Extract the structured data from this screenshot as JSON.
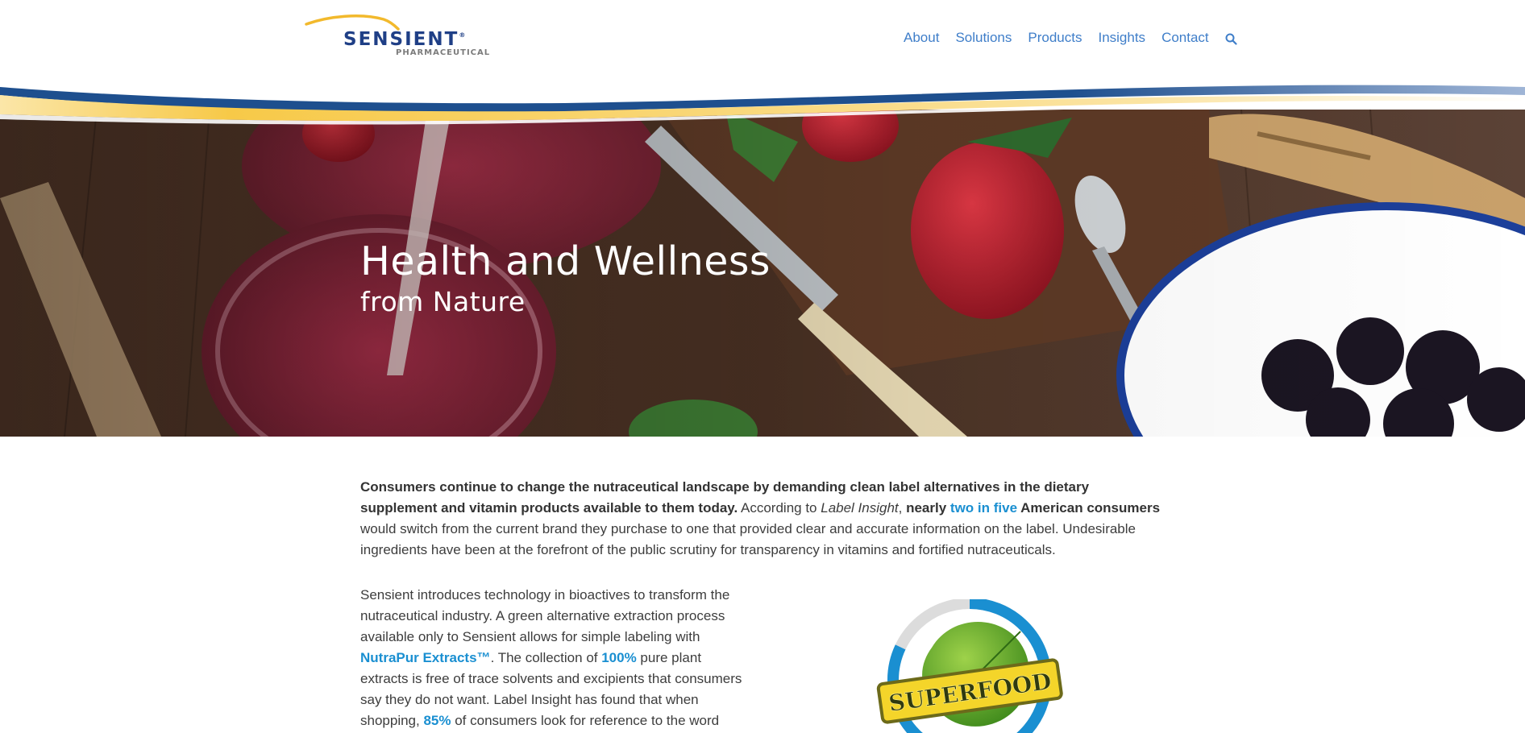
{
  "brand": {
    "name": "SENSIENT",
    "registered": "®",
    "division": "PHARMACEUTICAL"
  },
  "nav": {
    "items": [
      "About",
      "Solutions",
      "Products",
      "Insights",
      "Contact"
    ],
    "search_icon": "search-icon"
  },
  "hero": {
    "title": "Health and Wellness",
    "subtitle": "from Nature"
  },
  "lead": {
    "bold_intro": "Consumers continue to change the nutraceutical landscape by demanding clean label alternatives in the dietary supplement and vitamin products available to them today.",
    "according_to": " According to ",
    "source": "Label Insight",
    "comma": ", ",
    "nearly": "nearly ",
    "stat": "two in five",
    "american_consumers": " American consumers",
    "rest": " would switch from the current brand they purchase to one that provided clear and accurate information on the label. Undesirable ingredients have been at the forefront of the public scrutiny for transparency in vitamins and fortified nutraceuticals."
  },
  "para": {
    "part1": "Sensient introduces technology in bioactives to transform the nutraceutical industry. A green alternative extraction process available only to Sensient allows for simple labeling with ",
    "product": "NutraPur Extracts™",
    "part2": ". The collection of ",
    "stat1": "100%",
    "part3": " pure plant extracts is free of trace solvents and excipients that consumers say they do not want. Label Insight has found that when shopping, ",
    "stat2": "85%",
    "part4": " of consumers look for reference to the word"
  },
  "badge": {
    "label": "SUPERFOOD",
    "progress_fraction": 0.82
  },
  "colors": {
    "brand_blue": "#1f3f86",
    "nav_link": "#3f7ec9",
    "highlight": "#1a8fd1",
    "wave_yellow": "#f7c948",
    "wave_blue": "#1e4f8e"
  }
}
